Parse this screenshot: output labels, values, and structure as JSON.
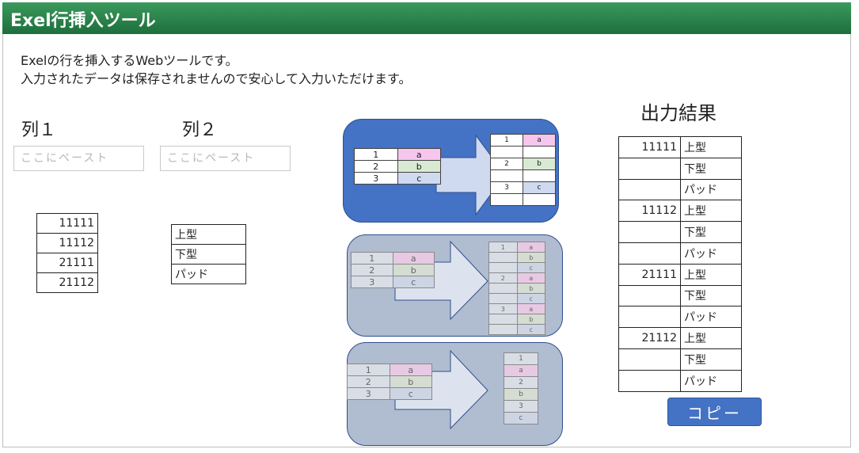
{
  "app": {
    "title": "Exel行挿入ツール"
  },
  "description": {
    "line1": "Exelの行を挿入するWebツールです。",
    "line2": "入力されたデータは保存されませんので安心して入力いただけます。"
  },
  "column1": {
    "label": "列１",
    "placeholder": "ここにペースト",
    "values": [
      "11111",
      "11112",
      "21111",
      "21112"
    ]
  },
  "column2": {
    "label": "列２",
    "placeholder": "ここにペースト",
    "values": [
      "上型",
      "下型",
      "パッド"
    ]
  },
  "output": {
    "title": "出力結果",
    "rows": [
      [
        "11111",
        "上型"
      ],
      [
        "",
        "下型"
      ],
      [
        "",
        "パッド"
      ],
      [
        "11112",
        "上型"
      ],
      [
        "",
        "下型"
      ],
      [
        "",
        "パッド"
      ],
      [
        "21111",
        "上型"
      ],
      [
        "",
        "下型"
      ],
      [
        "",
        "パッド"
      ],
      [
        "21112",
        "上型"
      ],
      [
        "",
        "下型"
      ],
      [
        "",
        "パッド"
      ]
    ]
  },
  "copy_button": {
    "label": "コピー"
  },
  "examples": {
    "input": [
      [
        "1",
        "a"
      ],
      [
        "2",
        "b"
      ],
      [
        "3",
        "c"
      ]
    ],
    "option1_output": [
      [
        "1",
        "a"
      ],
      [
        "",
        ""
      ],
      [
        "2",
        "b"
      ],
      [
        "",
        ""
      ],
      [
        "3",
        "c"
      ],
      [
        "",
        ""
      ]
    ],
    "option2_output": [
      [
        "1",
        "a"
      ],
      [
        "",
        "b"
      ],
      [
        "",
        "c"
      ],
      [
        "2",
        "a"
      ],
      [
        "",
        "b"
      ],
      [
        "",
        "c"
      ],
      [
        "3",
        "a"
      ],
      [
        "",
        "b"
      ],
      [
        "",
        "c"
      ]
    ],
    "option3_output": [
      "1",
      "a",
      "2",
      "b",
      "3",
      "c"
    ]
  },
  "colors": {
    "title_bar": "#1e7a43",
    "accent": "#4472c4",
    "panel_gray": "#b0bccf",
    "cell_a": "#f7c6ee",
    "cell_b": "#d9ead3",
    "cell_c": "#cfd9ef"
  }
}
